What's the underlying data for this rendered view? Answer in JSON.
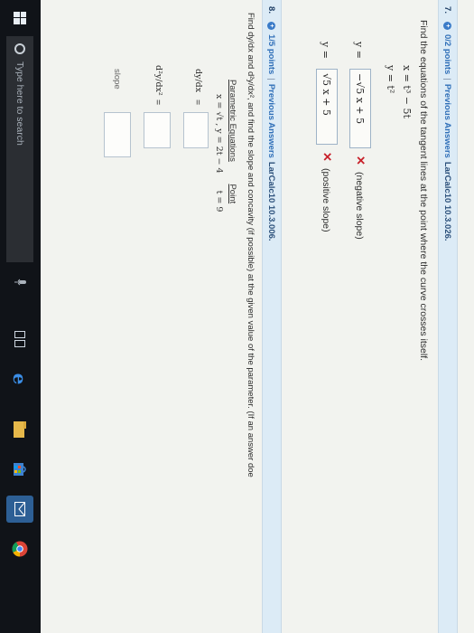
{
  "q7": {
    "number": "7.",
    "points": "0/2 points",
    "sep": "|",
    "prev": "Previous Answers",
    "code": "LarCalc10 10.3.026.",
    "prompt": "Find the equations of the tangent lines at the point where the curve crosses itself.",
    "eq_x": "x = t³ − 5t",
    "eq_y": "y = t²",
    "ans1_prefix": "y =",
    "ans1_value": "−√5 x + 5",
    "ans1_note": "(negative slope)",
    "ans2_prefix": "y =",
    "ans2_value": "√5 x + 5",
    "ans2_note": "(positive slope)",
    "wrong_mark": "✕"
  },
  "q8": {
    "number": "8.",
    "points": "1/5 points",
    "sep": "|",
    "prev": "Previous Answers",
    "code": "LarCalc10 10.3.006.",
    "prompt": "Find dy/dx and d²y/dx², and find the slope and concavity (if possible) at the given value of the parameter. (If an answer doe",
    "param_header": "Parametric Equations",
    "point_header": "Point",
    "param_value": "x = √t ,  y = 2t − 4",
    "point_value": "t = 9",
    "dydx_label": "dy/dx",
    "d2y_label": "d²y/dx²",
    "equals": "=",
    "slope_label": "slope"
  },
  "taskbar": {
    "search_placeholder": "Type here to search",
    "start_icon": "windows-logo-icon",
    "mic_icon": "microphone-icon",
    "task_view_icon": "task-view-icon",
    "edge_icon": "edge-browser-icon",
    "files_icon": "file-explorer-icon",
    "store_icon": "store-icon",
    "mail_icon": "mail-icon",
    "chrome_icon": "chrome-icon"
  },
  "colors": {
    "header_bg": "#dcebf6",
    "link": "#2f6fb8",
    "wrong": "#c8202a",
    "taskbar": "#101318"
  }
}
